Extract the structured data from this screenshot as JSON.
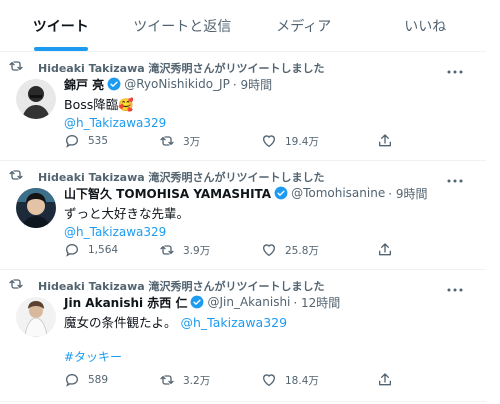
{
  "tabs": [
    "ツイート",
    "ツイートと返信",
    "メディア",
    "いいね"
  ],
  "tweets": [
    {
      "retweet_text": "Hideaki Takizawa 滝沢秀明さんがリツイートしました",
      "name": "錦戸 亮",
      "handle": "@RyoNishikido_JP",
      "time": "· 9時間",
      "text": "Boss降臨🥰",
      "mention": "@h_Takizawa329",
      "stats": {
        "replies": "535",
        "retweets": "3万",
        "likes": "19.4万"
      }
    },
    {
      "retweet_text": "Hideaki Takizawa 滝沢秀明さんがリツイートしました",
      "name": "山下智久 TOMOHISA YAMASHITA",
      "handle": "@Tomohisanine",
      "time": "· 9時間",
      "text": "ずっと大好きな先輩。",
      "mention": "@h_Takizawa329",
      "stats": {
        "replies": "1,564",
        "retweets": "3.9万",
        "likes": "25.8万"
      }
    },
    {
      "retweet_text": "Hideaki Takizawa 滝沢秀明さんがリツイートしました",
      "name": "Jin Akanishi 赤西 仁",
      "handle": "@Jin_Akanishi",
      "time": "· 12時間",
      "text": "魔女の条件観たよ。",
      "mention": "@h_Takizawa329",
      "hashtag": "#タッキー",
      "stats": {
        "replies": "589",
        "retweets": "3.2万",
        "likes": "18.4万"
      }
    }
  ],
  "colors": {
    "accent": "#1d9bf0",
    "muted": "#536471",
    "text": "#0f1419"
  },
  "icons": [
    "retweet-icon",
    "verified-badge-icon",
    "more-icon",
    "reply-icon",
    "like-icon",
    "share-icon"
  ]
}
